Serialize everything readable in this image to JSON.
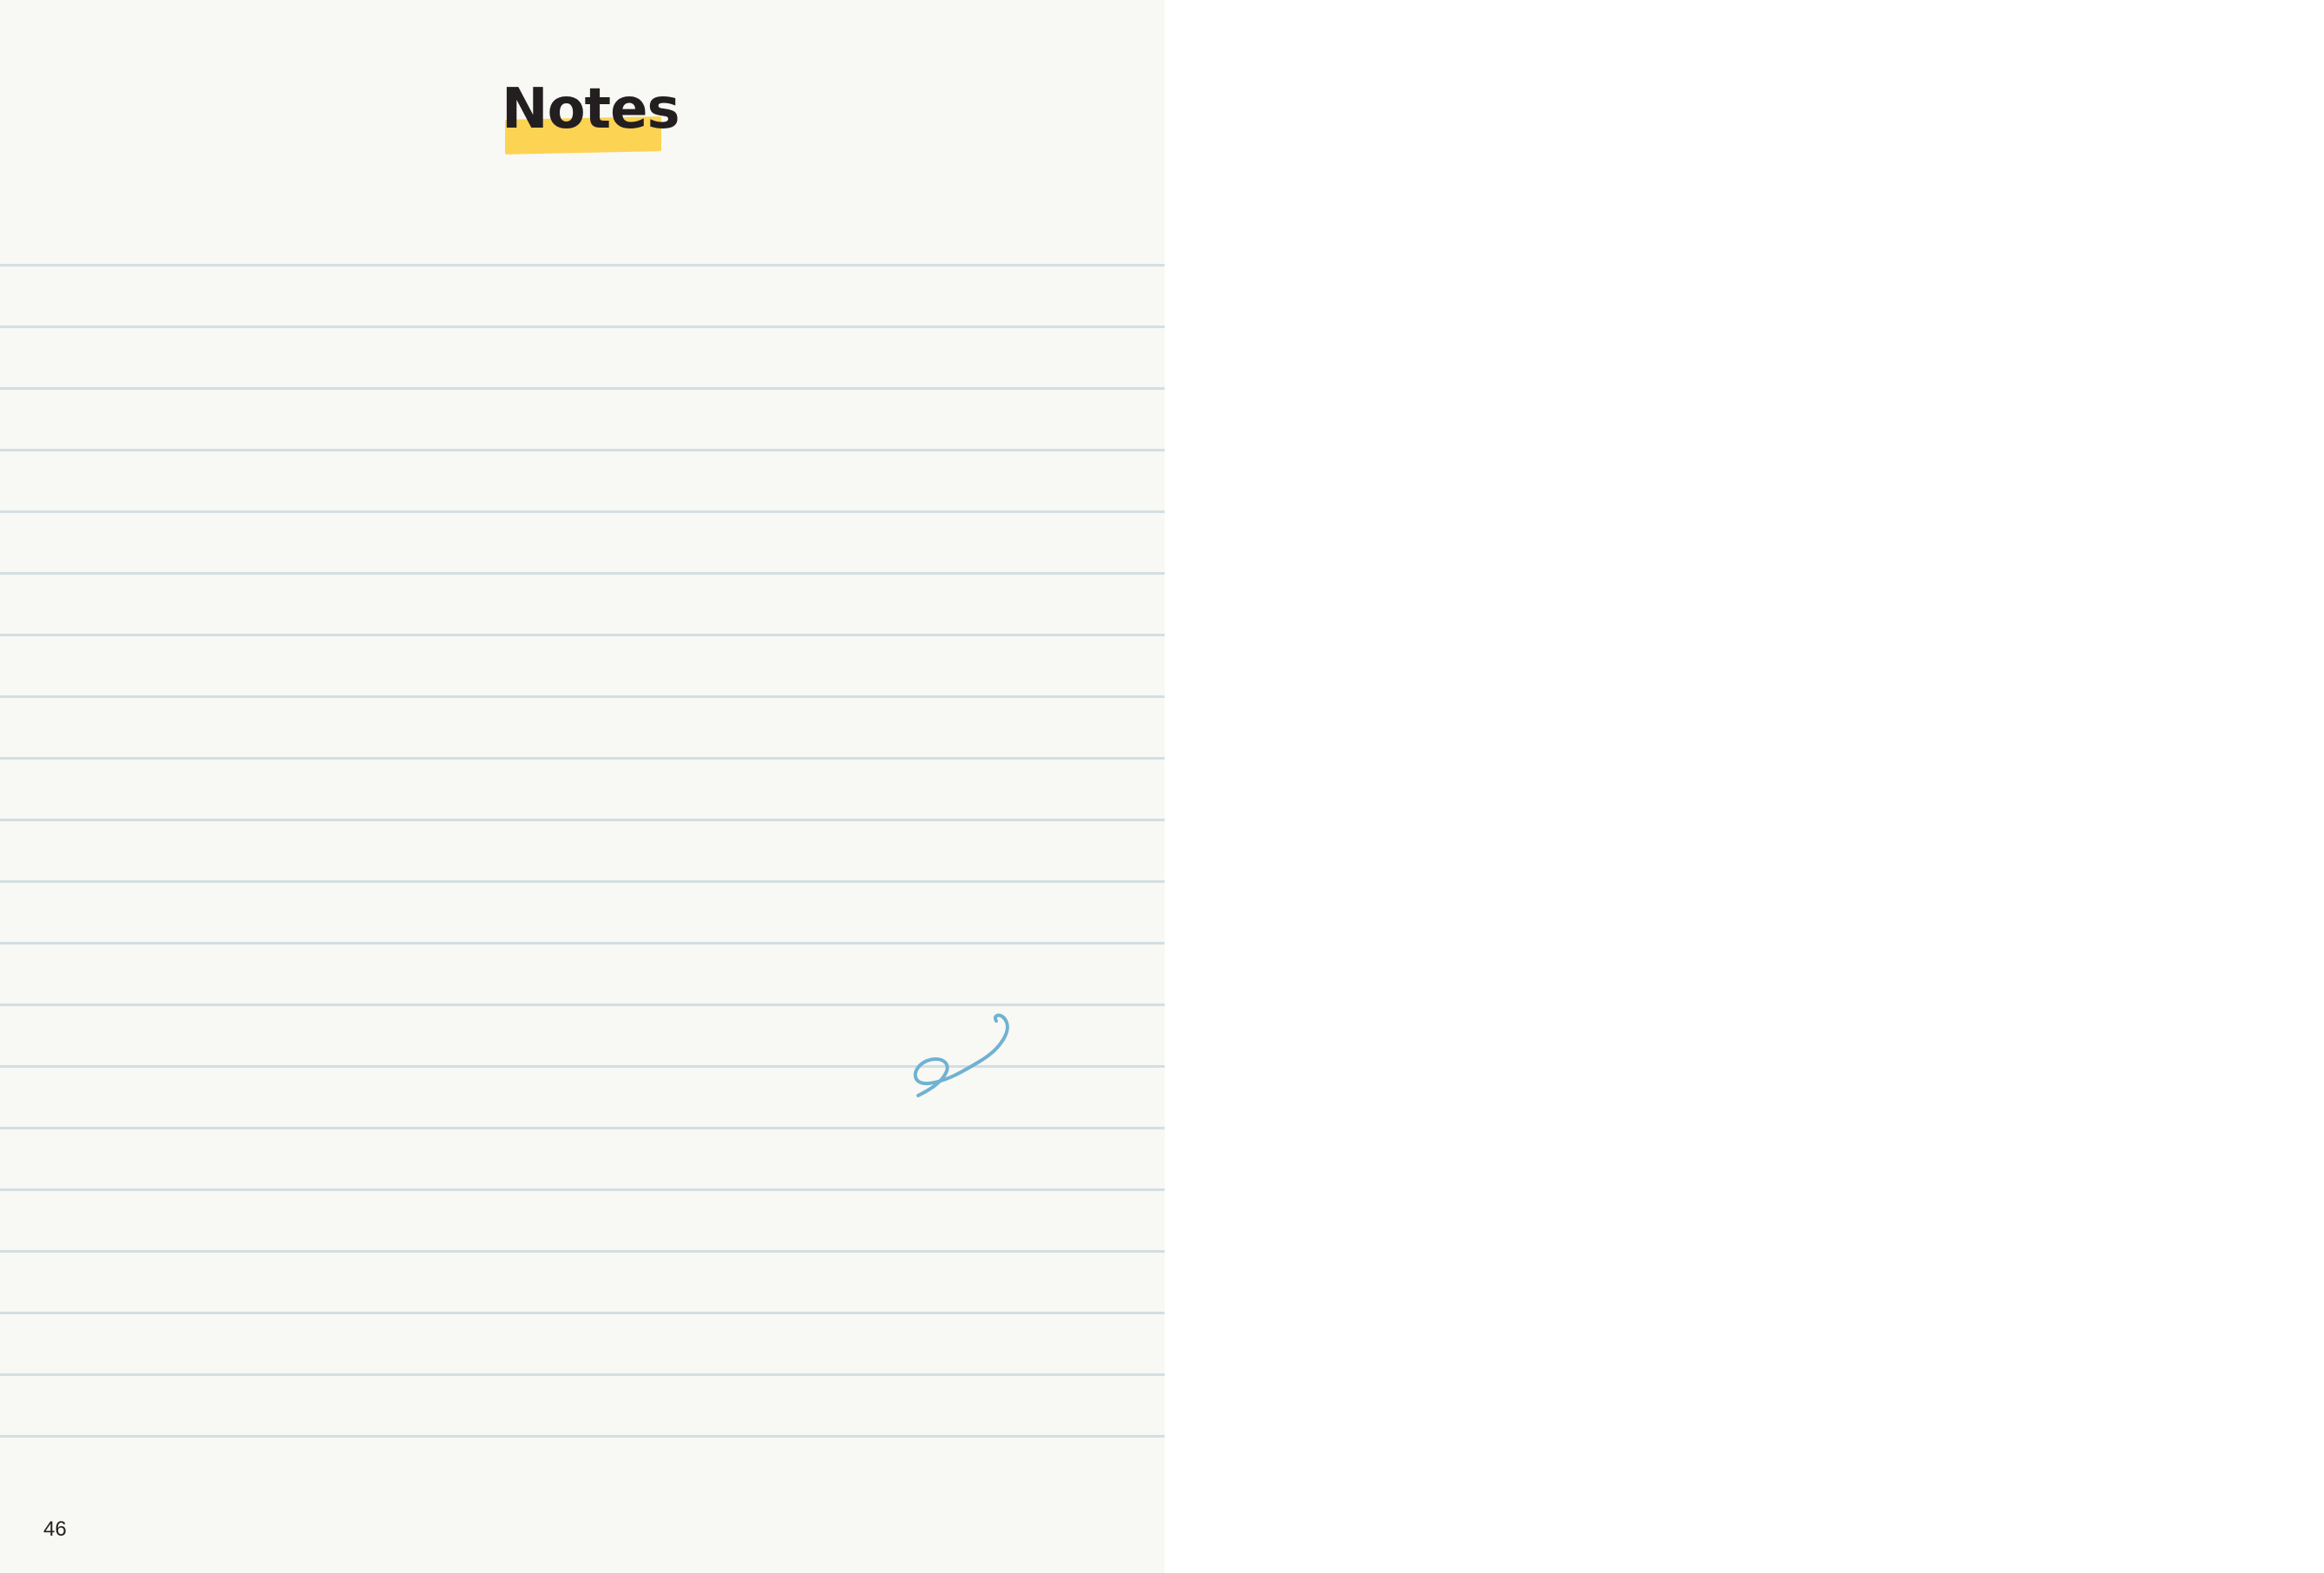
{
  "page": {
    "title": "Notes",
    "page_number": "46",
    "ruled_line_count": 20
  },
  "colors": {
    "page_background": "#f8f8f4",
    "highlight": "#fcd353",
    "ruled_line": "#d3dfe2",
    "swirl": "#6fb2d2",
    "text": "#231f20"
  },
  "icons": {
    "decoration": "swirl-doodle-icon"
  }
}
